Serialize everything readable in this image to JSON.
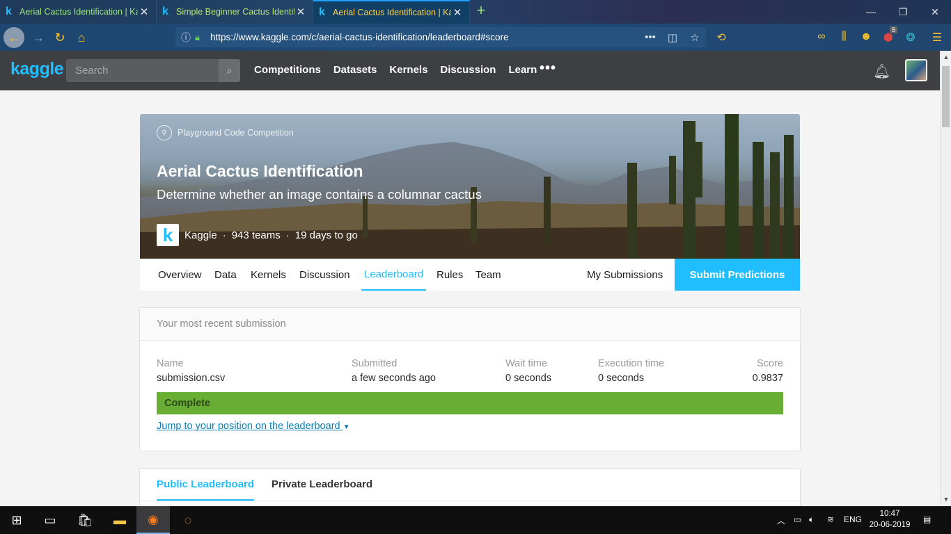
{
  "browser": {
    "tabs": [
      {
        "title": "Aerial Cactus Identification | Ka",
        "favicon": "k",
        "active": false
      },
      {
        "title": "Simple Beginner Cactus Identif",
        "favicon": "k",
        "active": false
      },
      {
        "title": "Aerial Cactus Identification | Ka",
        "favicon": "k",
        "active": true
      }
    ],
    "url": "https://www.kaggle.com/c/aerial-cactus-identification/leaderboard#score",
    "notification_badge": "5"
  },
  "kaggle_header": {
    "logo": "kaggle",
    "search_placeholder": "Search",
    "nav": [
      "Competitions",
      "Datasets",
      "Kernels",
      "Discussion",
      "Learn"
    ],
    "more": "•••"
  },
  "competition": {
    "badge": "Playground Code Competition",
    "title": "Aerial Cactus Identification",
    "subtitle": "Determine whether an image contains a columnar cactus",
    "host_logo": "k",
    "host": "Kaggle",
    "teams": "943 teams",
    "deadline": "19 days to go",
    "separator": "·",
    "tabs": [
      "Overview",
      "Data",
      "Kernels",
      "Discussion",
      "Leaderboard",
      "Rules",
      "Team"
    ],
    "active_tab": "Leaderboard",
    "my_submissions": "My Submissions",
    "submit_button": "Submit Predictions"
  },
  "submission": {
    "heading": "Your most recent submission",
    "name_label": "Name",
    "name_value": "submission.csv",
    "submitted_label": "Submitted",
    "submitted_value": "a few seconds ago",
    "wait_label": "Wait time",
    "wait_value": "0 seconds",
    "exec_label": "Execution time",
    "exec_value": "0 seconds",
    "score_label": "Score",
    "score_value": "0.9837",
    "status": "Complete",
    "status_color": "#68ad34",
    "jump_link": "Jump to your position on the leaderboard"
  },
  "leaderboard_tabs": {
    "public": "Public Leaderboard",
    "private": "Private Leaderboard"
  },
  "taskbar": {
    "language": "ENG",
    "time": "10:47",
    "date": "20-06-2019"
  },
  "colors": {
    "kaggle_blue": "#20beff",
    "header_bg": "#3e3f42"
  }
}
